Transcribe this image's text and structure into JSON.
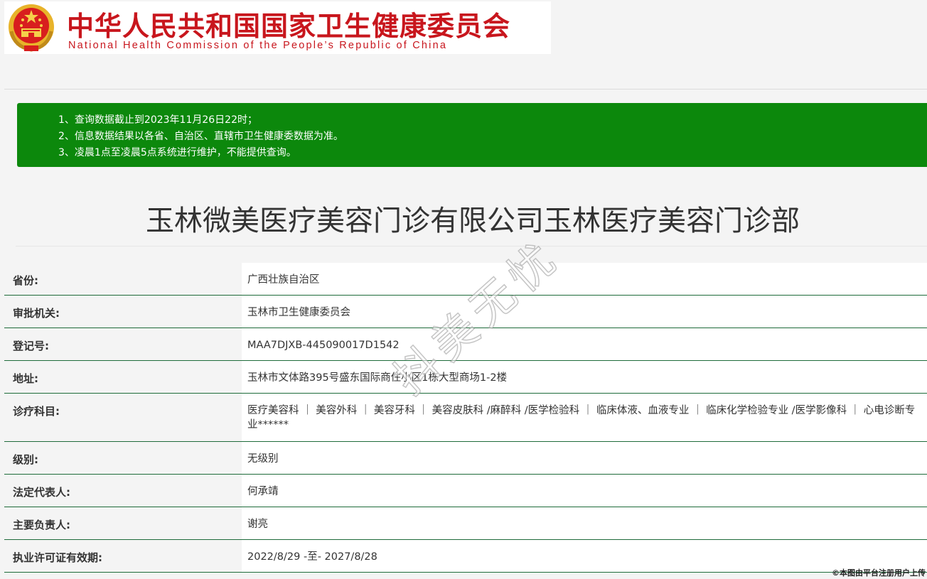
{
  "header": {
    "title_cn": "中华人民共和国国家卫生健康委员会",
    "title_en": "National Health Commission of the People’s Republic of China",
    "emblem_icon": "national-emblem-icon",
    "brand_color": "#c8161d"
  },
  "notice": {
    "background": "#0c880c",
    "lines": [
      "1、查询数据截止到2023年11月26日22时；",
      "2、信息数据结果以各省、自治区、直辖市卫生健康委数据为准。",
      "3、凌晨1点至凌晨5点系统进行维护，不能提供查询。"
    ]
  },
  "page_title": "玉林微美医疗美容门诊有限公司玉林医疗美容门诊部",
  "details": [
    {
      "label": "省份:",
      "value": "广西壮族自治区"
    },
    {
      "label": "审批机关:",
      "value": "玉林市卫生健康委员会"
    },
    {
      "label": "登记号:",
      "value": "MAA7DJXB-445090017D1542"
    },
    {
      "label": "地址:",
      "value": "玉林市文体路395号盛东国际商住小区1栋大型商场1-2楼"
    },
    {
      "label": "诊疗科目:",
      "value": "医疗美容科 ｜ 美容外科 ｜ 美容牙科 ｜ 美容皮肤科 /麻醉科 /医学检验科 ｜ 临床体液、血液专业 ｜ 临床化学检验专业 /医学影像科 ｜ 心电诊断专业******"
    },
    {
      "label": "级别:",
      "value": "无级别"
    },
    {
      "label": "法定代表人:",
      "value": "何承靖"
    },
    {
      "label": "主要负责人:",
      "value": "谢亮"
    },
    {
      "label": "执业许可证有效期:",
      "value": "2022/8/29 -至- 2027/8/28"
    }
  ],
  "watermark": "抖美无忧",
  "footer_credit": "©本图由平台注册用户上传"
}
